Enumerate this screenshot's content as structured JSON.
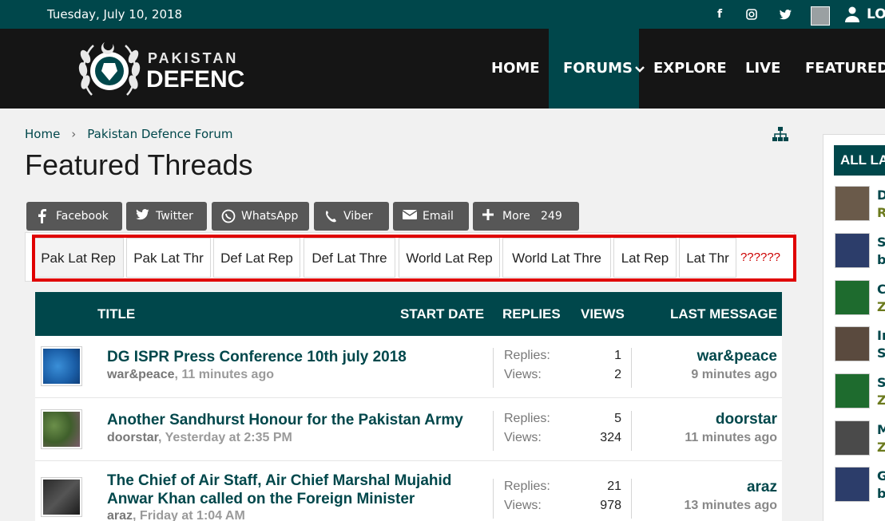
{
  "topbar": {
    "date": "Tuesday, July 10, 2018",
    "login_label": "LOG",
    "social": [
      {
        "icon": "facebook-icon",
        "glyph": "f"
      },
      {
        "icon": "instagram-icon",
        "glyph": "◎"
      },
      {
        "icon": "twitter-icon",
        "glyph": "✓"
      }
    ]
  },
  "header": {
    "logo_line1": "PAKISTAN",
    "logo_line2": "DEFENCE",
    "nav": [
      "HOME",
      "FORUMS",
      "EXPLORE",
      "LIVE",
      "FEATURED"
    ],
    "active_nav": "FORUMS"
  },
  "breadcrumb": [
    "Home",
    "Pakistan Defence Forum"
  ],
  "page_title": "Featured Threads",
  "share": {
    "buttons": [
      "Facebook",
      "Twitter",
      "WhatsApp",
      "Viber",
      "Email",
      "More"
    ],
    "more_count": "249"
  },
  "tabs": [
    "Pak Lat Rep",
    "Pak Lat Thr",
    "Def Lat Rep",
    "Def Lat Thre",
    "World Lat Rep",
    "World Lat Thre",
    "Lat Rep",
    "Lat Thr",
    "??????"
  ],
  "active_tab": "Pak Lat Rep",
  "table": {
    "headers": {
      "title": "TITLE",
      "start_date": "START DATE",
      "replies": "REPLIES",
      "views": "VIEWS",
      "last_message": "LAST MESSAGE"
    },
    "replies_label": "Replies:",
    "views_label": "Views:",
    "rows": [
      {
        "title": "DG ISPR Press Conference 10th july 2018",
        "author": "war&peace",
        "time": "11 minutes ago",
        "replies": "1",
        "views": "2",
        "last_user": "war&peace",
        "last_time": "9 minutes ago"
      },
      {
        "title": "Another Sandhurst Honour for the Pakistan Army",
        "author": "doorstar",
        "time": "Yesterday at 2:35 PM",
        "replies": "5",
        "views": "324",
        "last_user": "doorstar",
        "last_time": "11 minutes ago"
      },
      {
        "title": "The Chief of Air Staff, Air Chief Marshal Mujahid Anwar Khan called on the Foreign Minister",
        "author": "araz",
        "time": "Friday at 1:04 AM",
        "replies": "21",
        "views": "978",
        "last_user": "araz",
        "last_time": "13 minutes ago"
      }
    ]
  },
  "sidebar": {
    "heading": "ALL LA",
    "items": [
      {
        "a": "D",
        "b": "R"
      },
      {
        "a": "S",
        "b": "b"
      },
      {
        "a": "C",
        "b": "Z"
      },
      {
        "a": "Ir",
        "b": "S"
      },
      {
        "a": "S",
        "b": "Z"
      },
      {
        "a": "M",
        "b": "Z"
      },
      {
        "a": "G",
        "b": "b"
      }
    ]
  },
  "colors": {
    "brand": "#00474b",
    "header_bg": "#151515",
    "highlight": "#e00000",
    "share_bg": "#575757"
  }
}
